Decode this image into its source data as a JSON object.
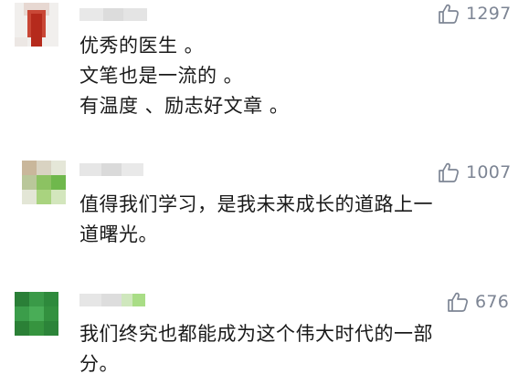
{
  "comments": [
    {
      "avatar": "avatar-blurred-red",
      "likes": "1297",
      "text": "优秀的医生 。\n文笔也是一流的 。\n有温度 、励志好文章 。"
    },
    {
      "avatar": "avatar-blurred-green-beige",
      "likes": "1007",
      "text": "值得我们学习，是我未来成长的道路上一\n道曙光。"
    },
    {
      "avatar": "avatar-blurred-green",
      "likes": "676",
      "text": "我们终究也都能成为这个伟大时代的一部\n分。"
    }
  ],
  "icons": {
    "like": "thumbs-up-icon"
  },
  "colors": {
    "text": "#1a1a1a",
    "meta": "#7d8594",
    "background": "#ffffff"
  }
}
